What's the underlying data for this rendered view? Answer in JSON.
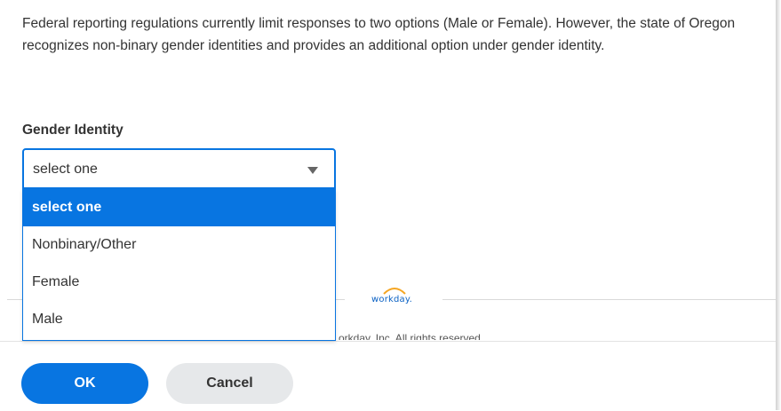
{
  "intro_text": "Federal reporting regulations currently limit responses to two options (Male or Female). However, the state of Oregon recognizes non-binary gender identities and provides an additional option under gender identity.",
  "field": {
    "label": "Gender Identity",
    "selected_value": "select one",
    "options": [
      "select one",
      "Nonbinary/Other",
      "Female",
      "Male"
    ]
  },
  "footer": {
    "logo_text": "workday.",
    "copyright": "orkday, Inc. All rights reserved."
  },
  "actions": {
    "ok_label": "OK",
    "cancel_label": "Cancel"
  },
  "colors": {
    "accent": "#0875e1",
    "cancel_bg": "#e6e8ea"
  }
}
